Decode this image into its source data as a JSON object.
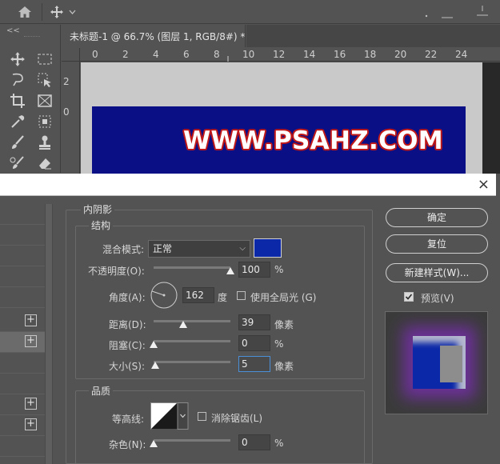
{
  "document": {
    "tab_title": "未标题-1 @ 66.7% (图层 1, RGB/8#) *",
    "tab_close": "×",
    "ruler_h_ticks": [
      "0",
      "2",
      "4",
      "6",
      "8",
      "10",
      "12",
      "14",
      "16",
      "18",
      "20",
      "22",
      "24"
    ],
    "ruler_v_ticks": [
      "2",
      "0"
    ],
    "canvas_text": "WWW.PSAHZ.COM",
    "canvas_color": "#0a0f85"
  },
  "tools": {
    "collapse_label": "<<"
  },
  "dialog": {
    "close_label": "×",
    "section_title": "内阴影",
    "structure": {
      "title": "结构",
      "blend_mode_label": "混合模式:",
      "blend_mode_value": "正常",
      "color": "#0a28a8",
      "opacity_label": "不透明度(O):",
      "opacity_value": "100",
      "opacity_unit": "%",
      "opacity_level": 1.0,
      "angle_label": "角度(A):",
      "angle_value": "162",
      "angle_unit": "度",
      "global_light_label": "使用全局光 (G)",
      "global_light_checked": false,
      "distance_label": "距离(D):",
      "distance_value": "39",
      "distance_unit": "像素",
      "distance_level": 0.39,
      "choke_label": "阻塞(C):",
      "choke_value": "0",
      "choke_unit": "%",
      "choke_level": 0,
      "size_label": "大小(S):",
      "size_value": "5",
      "size_unit": "像素",
      "size_level": 0.02
    },
    "quality": {
      "title": "品质",
      "contour_label": "等高线:",
      "antialias_label": "消除锯齿(L)",
      "antialias_checked": false,
      "noise_label": "杂色(N):",
      "noise_value": "0",
      "noise_unit": "%",
      "noise_level": 0
    },
    "buttons": {
      "ok": "确定",
      "reset": "复位",
      "new_style": "新建样式(W)...",
      "preview_label": "预览(V)",
      "preview_checked": true
    }
  }
}
